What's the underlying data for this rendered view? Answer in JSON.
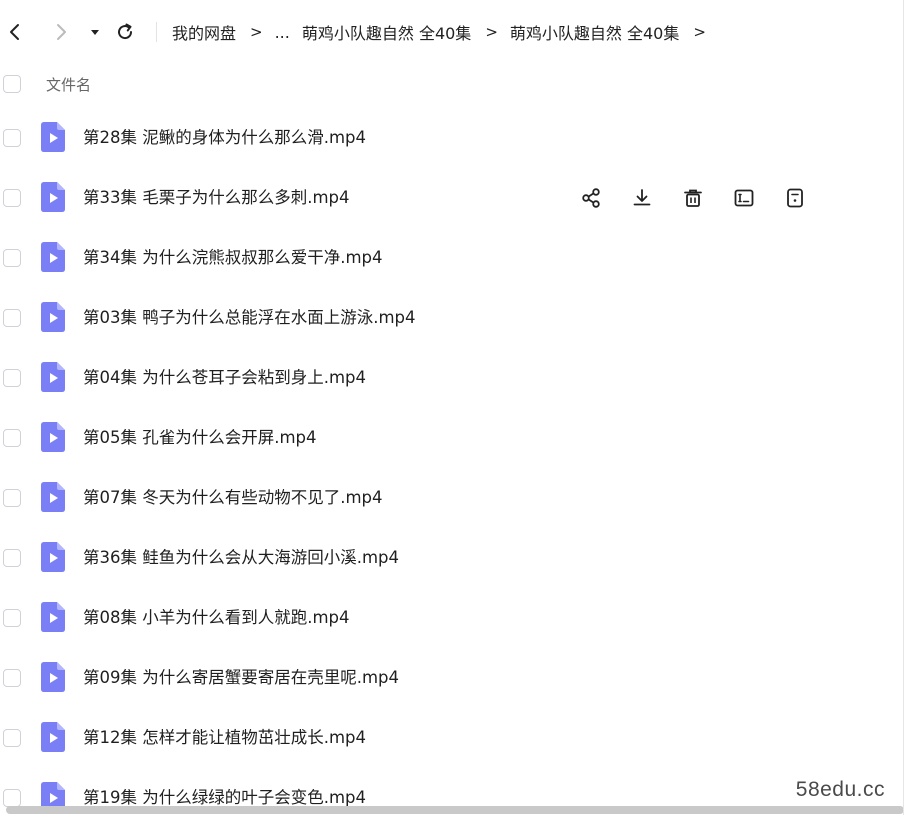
{
  "breadcrumb": {
    "items": [
      "我的网盘",
      "...",
      "萌鸡小队趣自然 全40集",
      "萌鸡小队趣自然 全40集"
    ],
    "separator": ">"
  },
  "header": {
    "name_column": "文件名"
  },
  "files": [
    {
      "name": "第28集 泥鳅的身体为什么那么滑.mp4"
    },
    {
      "name": "第33集 毛栗子为什么那么多刺.mp4"
    },
    {
      "name": "第34集 为什么浣熊叔叔那么爱干净.mp4"
    },
    {
      "name": "第03集 鸭子为什么总能浮在水面上游泳.mp4"
    },
    {
      "name": "第04集 为什么苍耳子会粘到身上.mp4"
    },
    {
      "name": "第05集 孔雀为什么会开屏.mp4"
    },
    {
      "name": "第07集 冬天为什么有些动物不见了.mp4"
    },
    {
      "name": "第36集 鲑鱼为什么会从大海游回小溪.mp4"
    },
    {
      "name": "第08集 小羊为什么看到人就跑.mp4"
    },
    {
      "name": "第09集 为什么寄居蟹要寄居在壳里呢.mp4"
    },
    {
      "name": "第12集 怎样才能让植物茁壮成长.mp4"
    },
    {
      "name": "第19集 为什么绿绿的叶子会变色.mp4"
    }
  ],
  "hover_row_index": 1,
  "row_actions": [
    "share-icon",
    "download-icon",
    "delete-icon",
    "rename-icon",
    "more-icon"
  ],
  "watermark": "58edu.cc",
  "colors": {
    "file_icon": "#7b7ff5",
    "file_icon_fold": "#b3b6ff",
    "checkbox_border": "#cfd2d8"
  }
}
